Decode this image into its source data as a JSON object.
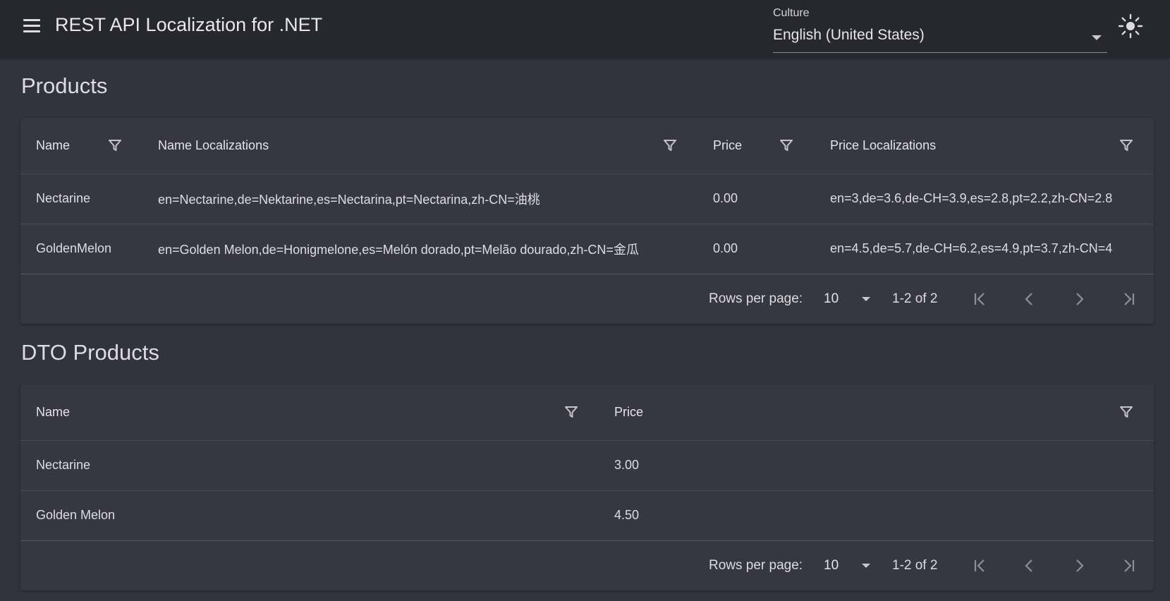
{
  "app": {
    "title": "REST API Localization for .NET"
  },
  "culture": {
    "label": "Culture",
    "value": "English (United States)"
  },
  "icons": {
    "menu": "hamburger-menu-icon",
    "theme": "sun-icon",
    "filter": "filter-funnel-icon",
    "dropdown": "triangle-down-icon",
    "first_page": "first-page-icon",
    "prev_page": "chevron-left-icon",
    "next_page": "chevron-right-icon",
    "last_page": "last-page-icon"
  },
  "colors": {
    "background": "#32333d",
    "appbar": "#27272f",
    "card": "#373741"
  },
  "products": {
    "title": "Products",
    "headers": {
      "name": "Name",
      "name_localizations": "Name Localizations",
      "price": "Price",
      "price_localizations": "Price Localizations"
    },
    "rows": [
      {
        "name": "Nectarine",
        "name_localizations": "en=Nectarine,de=Nektarine,es=Nectarina,pt=Nectarina,zh-CN=油桃",
        "price": "0.00",
        "price_localizations": "en=3,de=3.6,de-CH=3.9,es=2.8,pt=2.2,zh-CN=2.8"
      },
      {
        "name": "GoldenMelon",
        "name_localizations": "en=Golden Melon,de=Honigmelone,es=Melón dorado,pt=Melão dourado,zh-CN=金瓜",
        "price": "0.00",
        "price_localizations": "en=4.5,de=5.7,de-CH=6.2,es=4.9,pt=3.7,zh-CN=4"
      }
    ],
    "pager": {
      "rows_per_page_label": "Rows per page:",
      "rows_per_page": "10",
      "range": "1-2 of 2"
    }
  },
  "dto_products": {
    "title": "DTO Products",
    "headers": {
      "name": "Name",
      "price": "Price"
    },
    "rows": [
      {
        "name": "Nectarine",
        "price": "3.00"
      },
      {
        "name": "Golden Melon",
        "price": "4.50"
      }
    ],
    "pager": {
      "rows_per_page_label": "Rows per page:",
      "rows_per_page": "10",
      "range": "1-2 of 2"
    }
  }
}
